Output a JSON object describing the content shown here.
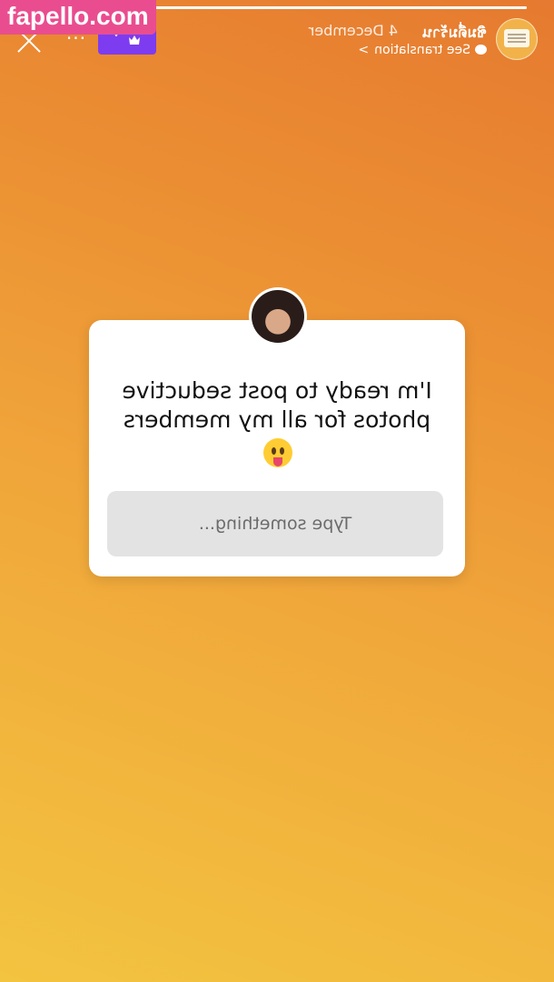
{
  "story": {
    "progress": 1.0,
    "header": {
      "username": "ชิมดื่มร้าน",
      "date": "4 December",
      "translation_label": "See translation",
      "translation_chevron": ">",
      "more_label": "···",
      "crown_chevron": "˅"
    },
    "question": {
      "text": "I'm ready to post seductive photos for all my members",
      "input_placeholder": "Type something..."
    }
  },
  "watermark": {
    "text": "fapello.com"
  },
  "colors": {
    "gradient_top": "#e67a30",
    "gradient_bottom": "#f3c440",
    "crown_badge": "#7d3cf0",
    "watermark_bg": "#e94d8f"
  },
  "icons": [
    "close-icon",
    "more-icon",
    "crown-icon",
    "chevron-down-icon",
    "chat-bubble-icon",
    "chevron-right-icon",
    "tongue-emoji-icon"
  ]
}
